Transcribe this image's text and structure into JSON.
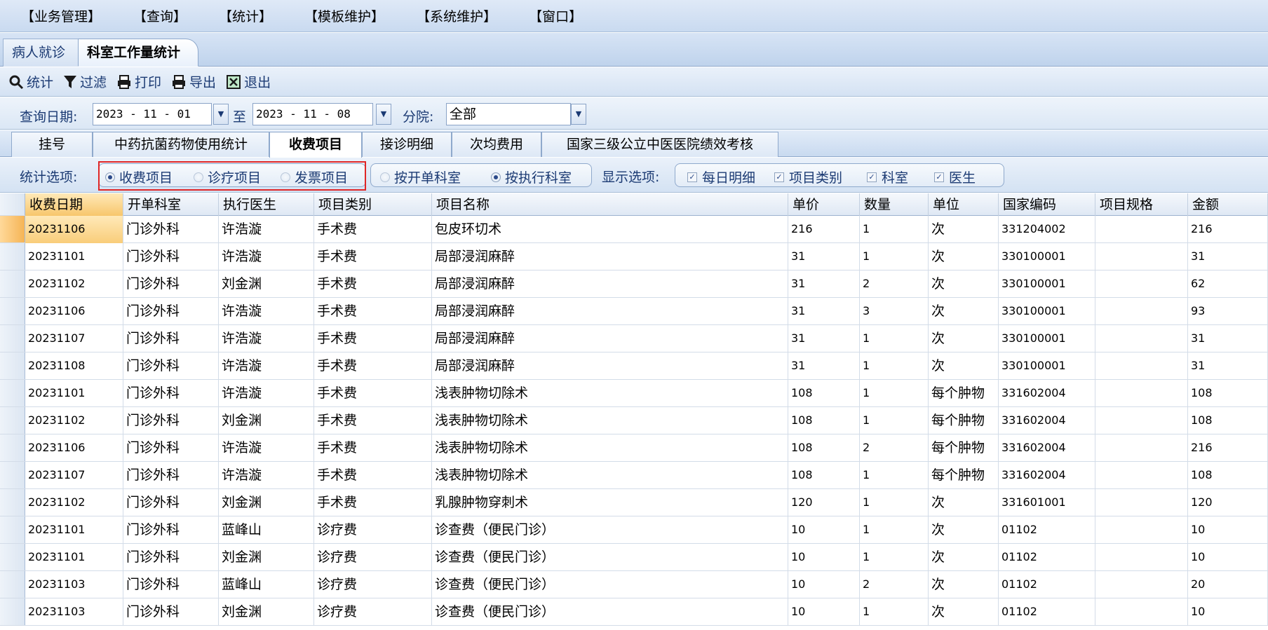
{
  "menu": [
    "【业务管理】",
    "【查询】",
    "【统计】",
    "【模板维护】",
    "【系统维护】",
    "【窗口】"
  ],
  "window_tabs": {
    "inactive": "病人就诊",
    "active": "科室工作量统计"
  },
  "toolbar": {
    "stat": "统计",
    "filter": "过滤",
    "print": "打印",
    "export": "导出",
    "exit": "退出"
  },
  "query": {
    "date_label": "查询日期:",
    "start_date": "2023 - 11 - 01",
    "to_label": "至",
    "end_date": "2023 - 11 - 08",
    "branch_label": "分院:",
    "branch_value": "全部"
  },
  "sub_tabs": [
    "挂号",
    "中药抗菌药物使用统计",
    "收费项目",
    "接诊明细",
    "次均费用",
    "国家三级公立中医医院绩效考核"
  ],
  "active_sub_tab": "收费项目",
  "options": {
    "stat_label": "统计选项:",
    "stat_charge": "收费项目",
    "stat_treat": "诊疗项目",
    "stat_invoice": "发票项目",
    "by_order_dept": "按开单科室",
    "by_exec_dept": "按执行科室",
    "display_label": "显示选项:",
    "daily_detail": "每日明细",
    "item_category": "项目类别",
    "dept": "科室",
    "doctor": "医生"
  },
  "table": {
    "columns": [
      "收费日期",
      "开单科室",
      "执行医生",
      "项目类别",
      "项目名称",
      "单价",
      "数量",
      "单位",
      "国家编码",
      "项目规格",
      "金额"
    ],
    "rows": [
      [
        "20231106",
        "门诊外科",
        "许浩漩",
        "手术费",
        "包皮环切术",
        "216",
        "1",
        "次",
        "331204002",
        "",
        "216"
      ],
      [
        "20231101",
        "门诊外科",
        "许浩漩",
        "手术费",
        "局部浸润麻醉",
        "31",
        "1",
        "次",
        "330100001",
        "",
        "31"
      ],
      [
        "20231102",
        "门诊外科",
        "刘金渊",
        "手术费",
        "局部浸润麻醉",
        "31",
        "2",
        "次",
        "330100001",
        "",
        "62"
      ],
      [
        "20231106",
        "门诊外科",
        "许浩漩",
        "手术费",
        "局部浸润麻醉",
        "31",
        "3",
        "次",
        "330100001",
        "",
        "93"
      ],
      [
        "20231107",
        "门诊外科",
        "许浩漩",
        "手术费",
        "局部浸润麻醉",
        "31",
        "1",
        "次",
        "330100001",
        "",
        "31"
      ],
      [
        "20231108",
        "门诊外科",
        "许浩漩",
        "手术费",
        "局部浸润麻醉",
        "31",
        "1",
        "次",
        "330100001",
        "",
        "31"
      ],
      [
        "20231101",
        "门诊外科",
        "许浩漩",
        "手术费",
        "浅表肿物切除术",
        "108",
        "1",
        "每个肿物",
        "331602004",
        "",
        "108"
      ],
      [
        "20231102",
        "门诊外科",
        "刘金渊",
        "手术费",
        "浅表肿物切除术",
        "108",
        "1",
        "每个肿物",
        "331602004",
        "",
        "108"
      ],
      [
        "20231106",
        "门诊外科",
        "许浩漩",
        "手术费",
        "浅表肿物切除术",
        "108",
        "2",
        "每个肿物",
        "331602004",
        "",
        "216"
      ],
      [
        "20231107",
        "门诊外科",
        "许浩漩",
        "手术费",
        "浅表肿物切除术",
        "108",
        "1",
        "每个肿物",
        "331602004",
        "",
        "108"
      ],
      [
        "20231102",
        "门诊外科",
        "刘金渊",
        "手术费",
        "乳腺肿物穿刺术",
        "120",
        "1",
        "次",
        "331601001",
        "",
        "120"
      ],
      [
        "20231101",
        "门诊外科",
        "蓝峰山",
        "诊疗费",
        "诊查费（便民门诊）",
        "10",
        "1",
        "次",
        "01102",
        "",
        "10"
      ],
      [
        "20231101",
        "门诊外科",
        "刘金渊",
        "诊疗费",
        "诊查费（便民门诊）",
        "10",
        "1",
        "次",
        "01102",
        "",
        "10"
      ],
      [
        "20231103",
        "门诊外科",
        "蓝峰山",
        "诊疗费",
        "诊查费（便民门诊）",
        "10",
        "2",
        "次",
        "01102",
        "",
        "20"
      ],
      [
        "20231103",
        "门诊外科",
        "刘金渊",
        "诊疗费",
        "诊查费（便民门诊）",
        "10",
        "1",
        "次",
        "01102",
        "",
        "10"
      ]
    ]
  },
  "colors": {
    "highlight_box": "#e02626",
    "selected_cell": "#f7c66c",
    "toolbar_text": "#1b3a73"
  }
}
